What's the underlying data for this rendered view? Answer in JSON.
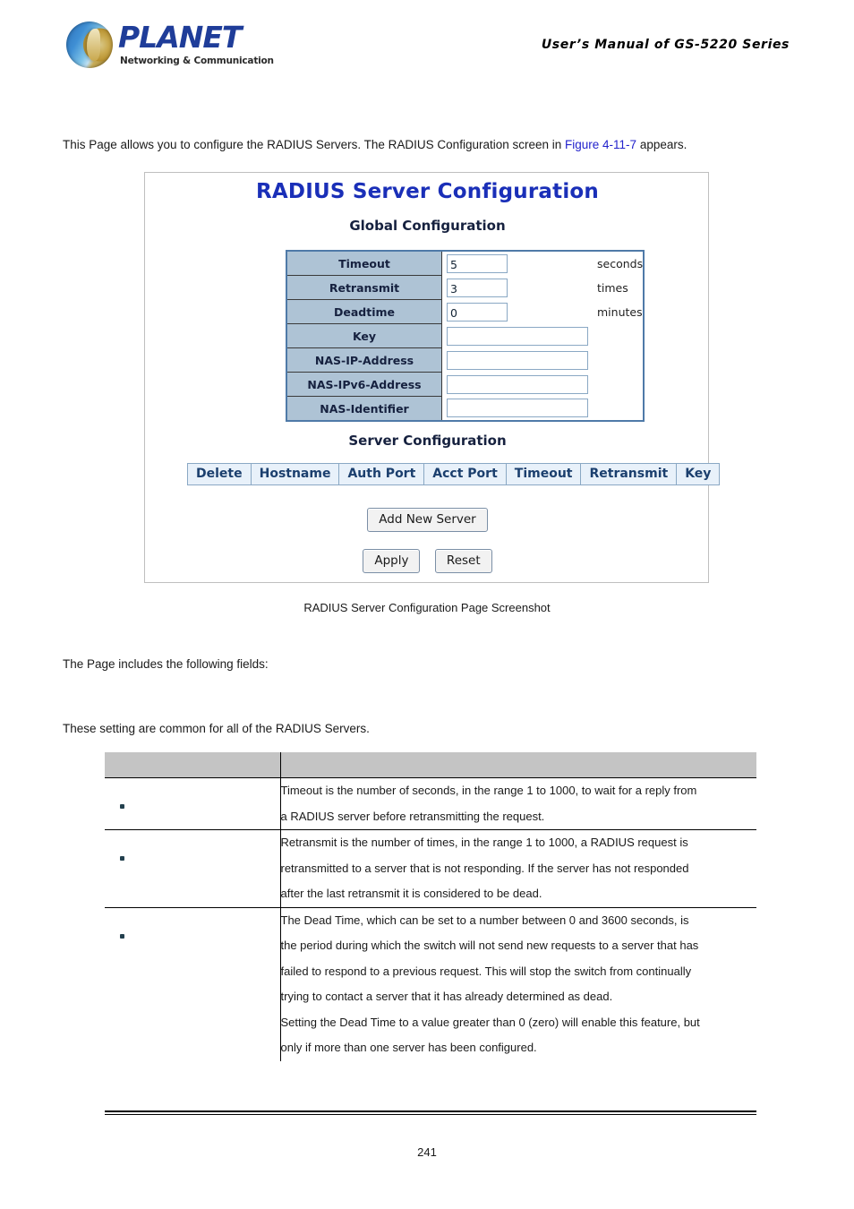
{
  "header": {
    "logo_word": "PLANET",
    "logo_tagline": "Networking & Communication",
    "logo_icon": "planet-globe-logo",
    "manual_title": "User’s Manual  of  GS-5220  Series"
  },
  "intro": {
    "text_before_link": "This Page allows you to configure the RADIUS Servers. The RADIUS Configuration screen in ",
    "link_text": "Figure 4-11-7",
    "text_after_link": " appears."
  },
  "screenshot": {
    "title": "RADIUS Server Configuration",
    "global_section_title": "Global Configuration",
    "global_rows": [
      {
        "label": "Timeout",
        "value": "5",
        "unit": "seconds",
        "width": "small"
      },
      {
        "label": "Retransmit",
        "value": "3",
        "unit": "times",
        "width": "small"
      },
      {
        "label": "Deadtime",
        "value": "0",
        "unit": "minutes",
        "width": "small"
      },
      {
        "label": "Key",
        "value": "",
        "unit": "",
        "width": "wide"
      },
      {
        "label": "NAS-IP-Address",
        "value": "",
        "unit": "",
        "width": "wide"
      },
      {
        "label": "NAS-IPv6-Address",
        "value": "",
        "unit": "",
        "width": "wide"
      },
      {
        "label": "NAS-Identifier",
        "value": "",
        "unit": "",
        "width": "wide"
      }
    ],
    "server_section_title": "Server Configuration",
    "server_table_headers": [
      "Delete",
      "Hostname",
      "Auth Port",
      "Acct Port",
      "Timeout",
      "Retransmit",
      "Key"
    ],
    "add_new_server_label": "Add New Server",
    "apply_label": "Apply",
    "reset_label": "Reset",
    "caption": "RADIUS Server Configuration Page Screenshot"
  },
  "after_shot": {
    "fields_intro": "The Page includes the following fields:",
    "common_note": "These setting are common for all of the RADIUS Servers."
  },
  "field_table": {
    "header": {
      "object_col": "",
      "description_col": ""
    },
    "rows": [
      {
        "object": "",
        "bullet": "•",
        "description_lines": [
          "Timeout is the number of seconds, in the range 1 to 1000, to wait for a reply from",
          "a RADIUS server before retransmitting the request."
        ]
      },
      {
        "object": "",
        "bullet": "•",
        "description_lines": [
          "Retransmit is the number of times, in the range 1 to 1000, a RADIUS request is",
          "retransmitted to a server that is not responding. If the server has not responded",
          "after the last retransmit it is considered to be dead."
        ]
      },
      {
        "object": "",
        "bullet": "•",
        "description_lines": [
          "The Dead Time, which can be set to a number between 0 and 3600 seconds, is",
          "the period during which the switch will not send new requests to a server that has",
          "failed to respond to a previous request. This will stop the switch from continually",
          "trying to contact a server that it has already determined as dead.",
          "Setting the Dead Time to a value greater than 0 (zero) will enable this feature, but",
          "only if more than one server has been configured."
        ]
      }
    ]
  },
  "footer": {
    "page_number": "241"
  }
}
